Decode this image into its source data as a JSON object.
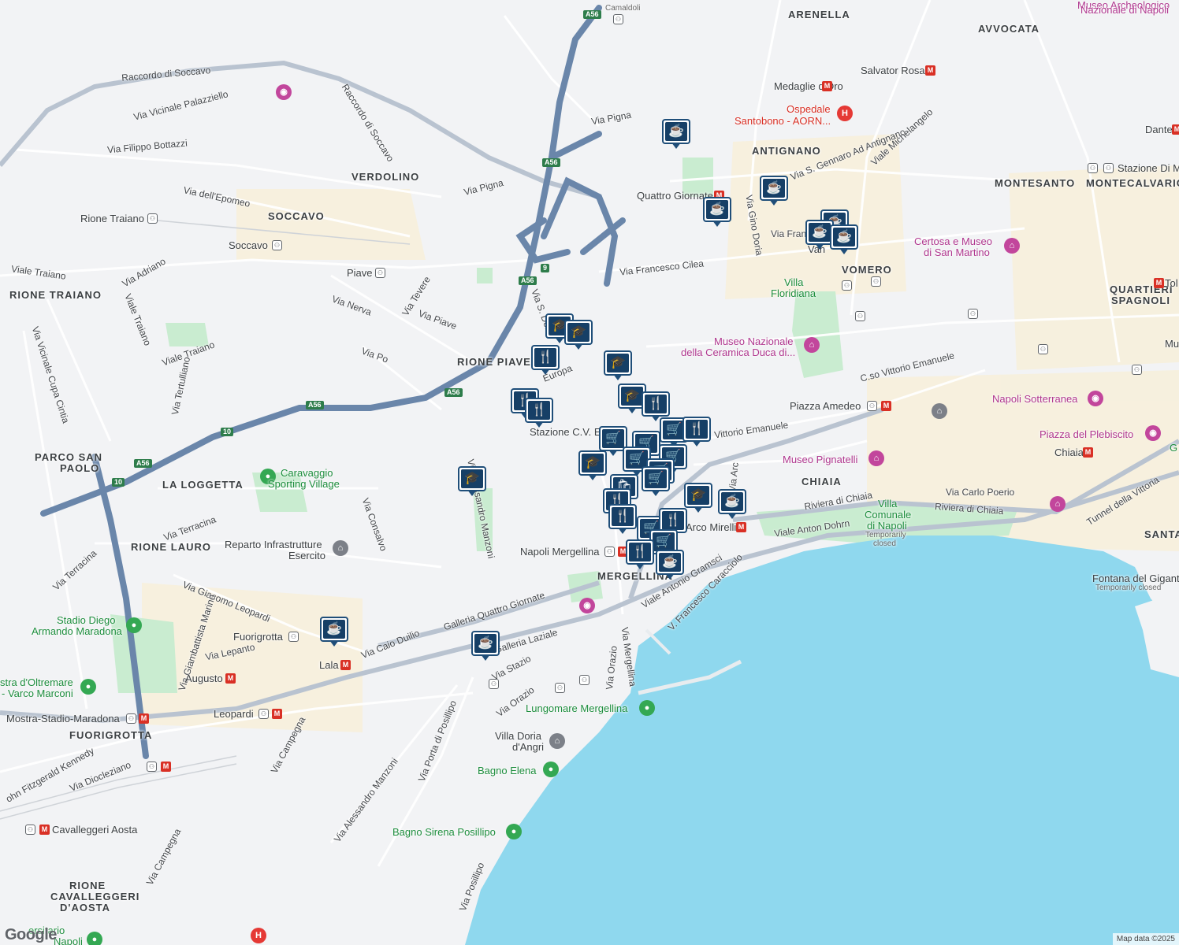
{
  "map": {
    "colors": {
      "water": "#8fd8ee",
      "land": "#f2f3f5",
      "park": "#c9ecd0",
      "highway": "#6a86aa",
      "marker": "#163f66"
    },
    "districts": {
      "arenella": "ARENELLA",
      "avvocata": "AVVOCATA",
      "verdolino": "VERDOLINO",
      "soccavo": "SOCCAVO",
      "antignano": "ANTIGNANO",
      "montesanto": "MONTESANTO",
      "montecalvario": "MONTECALVARIO",
      "vomero": "VOMERO",
      "rione_traiano": "RIONE TRAIANO",
      "rione_piave": "RIONE PIAVE",
      "quartieri_spagnoli_1": "QUARTIERI",
      "quartieri_spagnoli_2": "SPAGNOLI",
      "parco_san_paolo_1": "PARCO SAN",
      "parco_san_paolo_2": "PAOLO",
      "la_loggetta": "LA LOGGETTA",
      "chiaia": "CHIAIA",
      "rione_lauro": "RIONE LAURO",
      "mergellina": "MERGELLINA",
      "fuorigrotta": "FUORIGROTTA",
      "cavalleggeri_1": "RIONE",
      "cavalleggeri_2": "CAVALLEGGERI",
      "cavalleggeri_3": "D'AOSTA",
      "santa": "SANTA"
    },
    "streets": {
      "raccordo_soccavo_1": "Raccordo di Soccavo",
      "raccordo_soccavo_2": "Raccordo di Soccavo",
      "vicinale_palazziello": "Via Vicinale Palazziello",
      "filippo_bottazzi": "Via Filippo Bottazzi",
      "epomeo": "Via dell'Epomeo",
      "pigna_1": "Via Pigna",
      "pigna_2": "Via Pigna",
      "viale_traiano_1": "Viale Traiano",
      "viale_traiano_2": "Viale Traiano",
      "viale_traiano_3": "Viale Traiano",
      "via_adriano": "Via Adriano",
      "via_nerva": "Via Nerva",
      "via_tevere": "Via Tevere",
      "via_piave": "Via Piave",
      "via_po": "Via Po",
      "cupa_cintia": "Via Vicinale Cupa Cintia",
      "tertulliano": "Via Tertulliano",
      "francesco_cilea": "Via Francesco Cilea",
      "gino_doria": "Via Gino Doria",
      "san_gennaro": "Via S. Gennaro Ad Antignano",
      "michelangelo": "Viale Michelangelo",
      "via_franc": "Via Franc",
      "via_s_dom": "Via S. Dom",
      "europa": "Europa",
      "cso_vittorio": "C.so Vittorio Emanuele",
      "vittorio_emanuele": "Vittorio Emanuele",
      "terracina_1": "Via Terracina",
      "terracina_2": "Via Terracina",
      "consalvo": "Via Consalvo",
      "manzoni_1": "Via Alessandro Manzoni",
      "manzoni_2": "Via Alessandro Manzoni",
      "giacomo_leopardi": "Via Giacomo Leopardi",
      "giambattista_marino": "Via Giambattista Marino",
      "via_lepanto": "Via Lepanto",
      "caio_duilio": "Via Caio Duilio",
      "galleria_quattro_giornate": "Galleria Quattro Giornate",
      "galleria_laziale": "Galleria Laziale",
      "via_stazio": "Via Stazio",
      "via_orazio_1": "Via Orazio",
      "via_orazio_2": "Via Orazio",
      "via_mergellina": "Via Mergellina",
      "porta_posillipo": "Via Porta di Posillipo",
      "via_campegna_1": "Via Campegna",
      "via_campegna_2": "Via Campegna",
      "via_posillipo": "Via Posillipo",
      "diocleziano": "Via Diocleziano",
      "kennedy": "ohn Fitzgerald Kennedy",
      "riviera_chiaia_1": "Riviera di Chiaia",
      "riviera_chiaia_2": "Riviera di Chiaia",
      "anton_dohrn": "Viale Anton Dohrn",
      "antonio_gramsci": "Viale Antonio Gramsci",
      "francesco_caracciolo": "V. Francesco Caracciolo",
      "carlo_poerio": "Via Carlo Poerio",
      "tunnel_vittoria": "Tunnel della Vittoria",
      "via_arc": "Via Arc"
    },
    "highway_shields": {
      "a56_1": "A56",
      "a56_2": "A56",
      "a56_3": "A56",
      "a56_4": "A56",
      "a56_5": "A56",
      "a56_6": "A56",
      "r10_1": "10",
      "r10_2": "10",
      "r9": "9"
    },
    "pois": {
      "camaldoli": "Camaldoli",
      "museo_archeologico_1": "Museo Archeologico",
      "museo_archeologico_2": "Nazionale di Napoli",
      "medaglie_doro": "Medaglie d'Oro",
      "salvator_rosa": "Salvator Rosa",
      "ospedale_1": "Ospedale",
      "ospedale_2": "Santobono - AORN...",
      "dante": "Dante",
      "stazione_di_m": "Stazione Di M",
      "quattro_giornate": "Quattro Giornate",
      "vanvitelli": "Van",
      "rione_traiano_stop": "Rione Traiano",
      "soccavo_stop": "Soccavo",
      "piave_stop": "Piave",
      "certosa_1": "Certosa e Museo",
      "certosa_2": "di San Martino",
      "villa_floridiana_1": "Villa",
      "villa_floridiana_2": "Floridiana",
      "toledo": "Tol",
      "museo_ceramica_1": "Museo Nazionale",
      "museo_ceramica_2": "della Ceramica Duca di...",
      "mu": "Mu",
      "piazza_amedeo": "Piazza Amedeo",
      "napoli_sotterranea": "Napoli Sotterranea",
      "stazione_cv": "Stazione C.V. E",
      "piazza_plebiscito": "Piazza del Plebiscito",
      "chiaia_metro": "Chiaia",
      "museo_pignatelli": "Museo Pignatelli",
      "caravaggio_1": "Caravaggio",
      "caravaggio_2": "Sporting Village",
      "g_m": "G M",
      "villa_comunale_1": "Villa",
      "villa_comunale_2": "Comunale",
      "villa_comunale_3": "di Napoli",
      "villa_comunale_closed_1": "Temporarily",
      "villa_comunale_closed_2": "closed",
      "arco_mirelli": "Arco Mirelli",
      "reparto_1": "Reparto Infrastrutture",
      "reparto_2": "Esercito",
      "napoli_mergellina": "Napoli Mergellina",
      "fontana_gigante": "Fontana del Gigante",
      "fontana_closed": "Temporarily closed",
      "stadio_1": "Stadio Diego",
      "stadio_2": "Armando Maradona",
      "fuorigrotta_stop": "Fuorigrotta",
      "lala": "Lala",
      "mostra_1": "stra d'Oltremare",
      "mostra_2": "- Varco Marconi",
      "augusto": "Augusto",
      "mostra_stadio": "Mostra-Stadio-Maradona",
      "leopardi": "Leopardi",
      "lungomare": "Lungomare Mergellina",
      "villa_doria_1": "Villa Doria",
      "villa_doria_2": "d'Angri",
      "bagno_elena": "Bagno Elena",
      "cavalleggeri_aosta": "Cavalleggeri Aosta",
      "bagno_sirena": "Bagno Sirena Posillipo",
      "universitario_1": "ersitario",
      "universitario_2": "Napoli"
    },
    "markers": [
      {
        "icon": "cafe",
        "glyph": "☕"
      },
      {
        "icon": "cafe",
        "glyph": "☕"
      },
      {
        "icon": "cafe",
        "glyph": "☕"
      },
      {
        "icon": "cafe",
        "glyph": "☕"
      },
      {
        "icon": "cafe",
        "glyph": "☕"
      },
      {
        "icon": "cafe",
        "glyph": "☕"
      },
      {
        "icon": "school",
        "glyph": "🎓"
      },
      {
        "icon": "school",
        "glyph": "🎓"
      },
      {
        "icon": "restaurant",
        "glyph": "🍴"
      },
      {
        "icon": "school",
        "glyph": "🎓"
      },
      {
        "icon": "restaurant",
        "glyph": "🍴"
      },
      {
        "icon": "restaurant",
        "glyph": "🍴"
      },
      {
        "icon": "school",
        "glyph": "🎓"
      },
      {
        "icon": "restaurant",
        "glyph": "🍴"
      },
      {
        "icon": "shopping-cart",
        "glyph": "🛒"
      },
      {
        "icon": "restaurant",
        "glyph": "🍴"
      },
      {
        "icon": "shopping-cart",
        "glyph": "🛒"
      },
      {
        "icon": "shopping-cart",
        "glyph": "🛒"
      },
      {
        "icon": "shopping-cart",
        "glyph": "🛒"
      },
      {
        "icon": "school",
        "glyph": "🎓"
      },
      {
        "icon": "shopping-cart",
        "glyph": "🛒"
      },
      {
        "icon": "shopping-cart",
        "glyph": "🛒"
      },
      {
        "icon": "shopping-bag",
        "glyph": "🛍"
      },
      {
        "icon": "shopping-cart",
        "glyph": "🛒"
      },
      {
        "icon": "school",
        "glyph": "🎓"
      },
      {
        "icon": "restaurant",
        "glyph": "🍴"
      },
      {
        "icon": "cafe",
        "glyph": "☕"
      },
      {
        "icon": "restaurant",
        "glyph": "🍴"
      },
      {
        "icon": "shopping-cart",
        "glyph": "🛒"
      },
      {
        "icon": "restaurant",
        "glyph": "🍴"
      },
      {
        "icon": "shopping-cart",
        "glyph": "🛒"
      },
      {
        "icon": "restaurant",
        "glyph": "🍴"
      },
      {
        "icon": "cafe",
        "glyph": "☕"
      },
      {
        "icon": "school",
        "glyph": "🎓"
      },
      {
        "icon": "cafe",
        "glyph": "☕"
      }
    ],
    "google_logo": "Google",
    "attribution": "Map data ©2025"
  }
}
